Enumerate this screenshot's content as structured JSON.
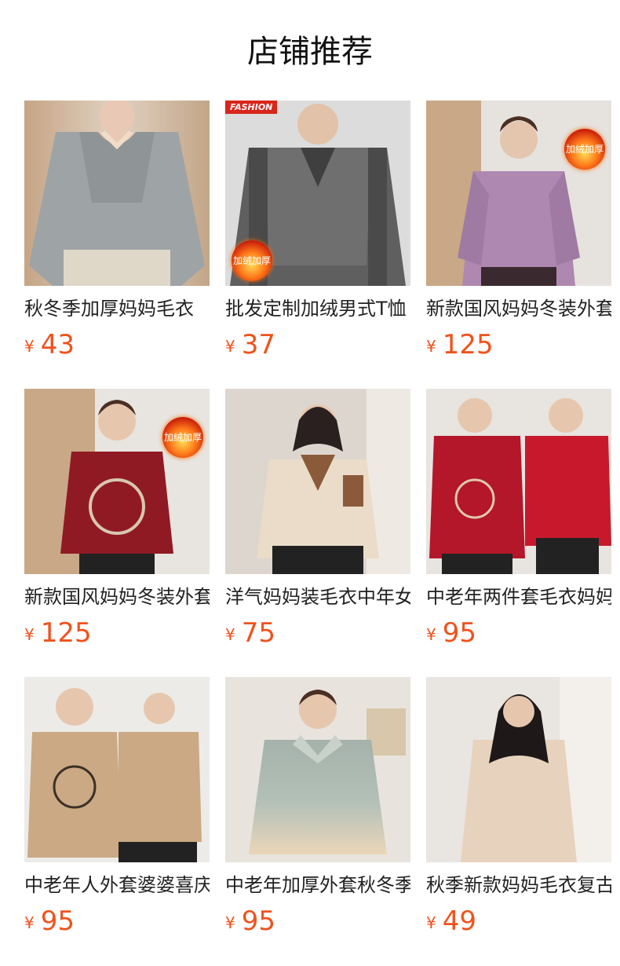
{
  "header": {
    "title": "店铺推荐"
  },
  "currency": "¥",
  "products": [
    {
      "name": "秋冬季加厚妈妈毛衣",
      "price": "43"
    },
    {
      "name": "批发定制加绒男式T恤",
      "price": "37",
      "badge_top": "FASHION",
      "badge_text": "加绒加厚"
    },
    {
      "name": "新款国风妈妈冬装外套",
      "price": "125",
      "badge_text": "加绒加厚"
    },
    {
      "name": "新款国风妈妈冬装外套",
      "price": "125",
      "badge_text": "加绒加厚"
    },
    {
      "name": "洋气妈妈装毛衣中年女",
      "price": "75"
    },
    {
      "name": "中老年两件套毛衣妈妈",
      "price": "95"
    },
    {
      "name": "中老年人外套婆婆喜庆",
      "price": "95"
    },
    {
      "name": "中老年加厚外套秋冬季",
      "price": "95"
    },
    {
      "name": "秋季新款妈妈毛衣复古",
      "price": "49"
    }
  ],
  "colors": {
    "price": "#f0521d"
  }
}
